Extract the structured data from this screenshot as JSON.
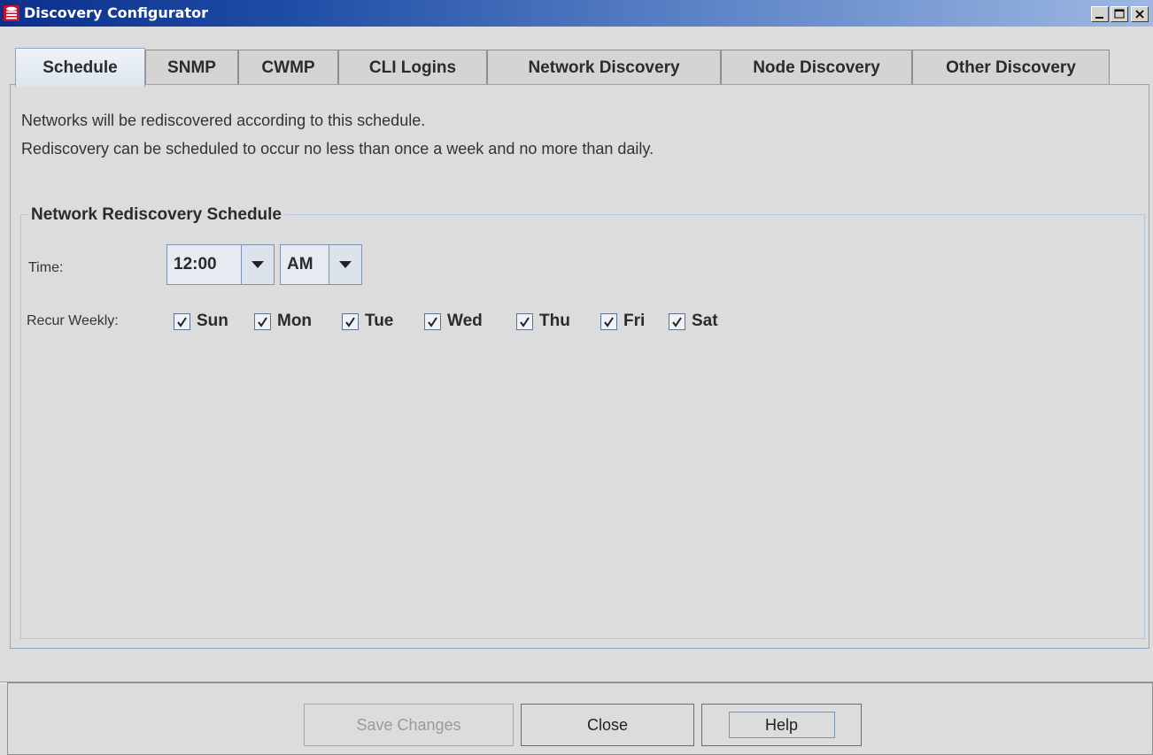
{
  "window": {
    "title": "Discovery Configurator",
    "icon": "red-database-icon",
    "controls": [
      "minimize-icon",
      "maximize-icon",
      "close-icon"
    ]
  },
  "tabs": [
    {
      "label": "Schedule",
      "active": true
    },
    {
      "label": "SNMP",
      "active": false
    },
    {
      "label": "CWMP",
      "active": false
    },
    {
      "label": "CLI Logins",
      "active": false
    },
    {
      "label": "Network Discovery",
      "active": false
    },
    {
      "label": "Node Discovery",
      "active": false
    },
    {
      "label": "Other Discovery",
      "active": false
    }
  ],
  "schedule": {
    "description_line1": "Networks will be rediscovered according to this schedule.",
    "description_line2": "Rediscovery can be scheduled to occur no less than once a week and no more than daily.",
    "group_title": "Network Rediscovery Schedule",
    "time_label": "Time:",
    "time_value": "12:00",
    "ampm_value": "AM",
    "recur_label": "Recur Weekly:",
    "days": [
      {
        "label": "Sun",
        "checked": true
      },
      {
        "label": "Mon",
        "checked": true
      },
      {
        "label": "Tue",
        "checked": true
      },
      {
        "label": "Wed",
        "checked": true
      },
      {
        "label": "Thu",
        "checked": true
      },
      {
        "label": "Fri",
        "checked": true
      },
      {
        "label": "Sat",
        "checked": true
      }
    ]
  },
  "footer": {
    "save_label": "Save Changes",
    "save_enabled": false,
    "close_label": "Close",
    "help_label": "Help"
  },
  "colors": {
    "title_bar_start": "#0c2f8c",
    "title_bar_end": "#9db8e3",
    "panel_border": "#8aa6c8",
    "background": "#dcdcdc"
  }
}
